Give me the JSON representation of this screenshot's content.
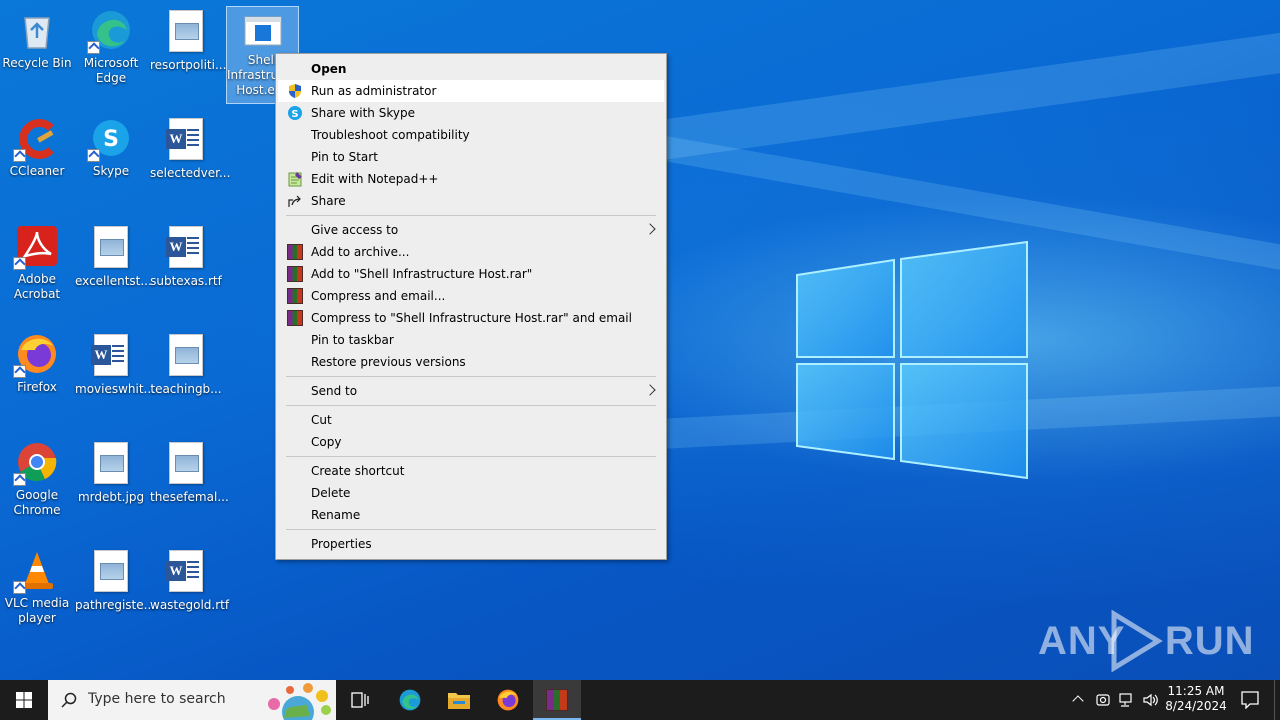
{
  "desktop": {
    "icons": [
      {
        "label": "Recycle Bin"
      },
      {
        "label": "Microsoft Edge"
      },
      {
        "label": "resortpoliti..."
      },
      {
        "label": "Shell Infrastructure Host.exe"
      },
      {
        "label": "CCleaner"
      },
      {
        "label": "Skype"
      },
      {
        "label": "selectedver..."
      },
      {
        "label": "Adobe Acrobat"
      },
      {
        "label": "excellentst..."
      },
      {
        "label": "subtexas.rtf"
      },
      {
        "label": "Firefox"
      },
      {
        "label": "movieswhit..."
      },
      {
        "label": "teachingb..."
      },
      {
        "label": "Google Chrome"
      },
      {
        "label": "mrdebt.jpg"
      },
      {
        "label": "thesefemal..."
      },
      {
        "label": "VLC media player"
      },
      {
        "label": "pathregiste..."
      },
      {
        "label": "wastegold.rtf"
      }
    ]
  },
  "context_menu": {
    "items": [
      {
        "label": "Open",
        "icon": ""
      },
      {
        "label": "Run as administrator",
        "icon": "uac-shield-icon"
      },
      {
        "label": "Share with Skype",
        "icon": "skype-icon"
      },
      {
        "label": "Troubleshoot compatibility",
        "icon": ""
      },
      {
        "label": "Pin to Start",
        "icon": ""
      },
      {
        "label": "Edit with Notepad++",
        "icon": "notepadpp-icon"
      },
      {
        "label": "Share",
        "icon": "share-icon"
      },
      {
        "label": "Give access to",
        "icon": "",
        "submenu": true
      },
      {
        "label": "Add to archive...",
        "icon": "winrar-icon"
      },
      {
        "label": "Add to \"Shell Infrastructure Host.rar\"",
        "icon": "winrar-icon"
      },
      {
        "label": "Compress and email...",
        "icon": "winrar-icon"
      },
      {
        "label": "Compress to \"Shell Infrastructure Host.rar\" and email",
        "icon": "winrar-icon"
      },
      {
        "label": "Pin to taskbar",
        "icon": ""
      },
      {
        "label": "Restore previous versions",
        "icon": ""
      },
      {
        "label": "Send to",
        "icon": "",
        "submenu": true
      },
      {
        "label": "Cut",
        "icon": ""
      },
      {
        "label": "Copy",
        "icon": ""
      },
      {
        "label": "Create shortcut",
        "icon": ""
      },
      {
        "label": "Delete",
        "icon": ""
      },
      {
        "label": "Rename",
        "icon": ""
      },
      {
        "label": "Properties",
        "icon": ""
      }
    ],
    "highlighted": "Run as administrator"
  },
  "taskbar": {
    "search_placeholder": "Type here to search",
    "time": "11:25 AM",
    "date": "8/24/2024"
  },
  "watermark": "ANY RUN",
  "colors": {
    "taskbar": "#1c1c1c",
    "menu_bg": "#eeeeee",
    "desktop_blue": "#0a6fd6"
  }
}
